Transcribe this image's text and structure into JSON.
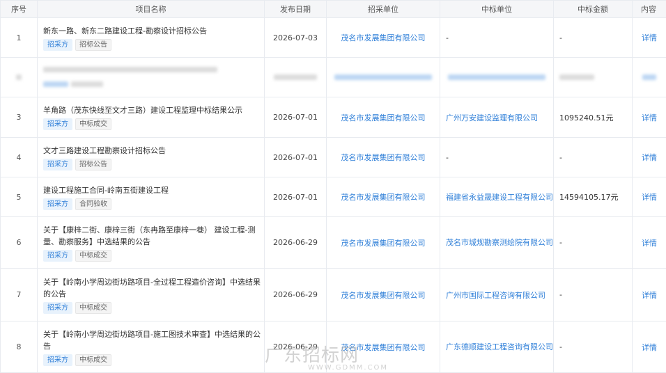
{
  "headers": {
    "no": "序号",
    "name": "项目名称",
    "date": "发布日期",
    "buyer": "招采单位",
    "winner": "中标单位",
    "amount": "中标金额",
    "content": "内容"
  },
  "rows": [
    {
      "no": "1",
      "title": "新东一路、新东二路建设工程-勘察设计招标公告",
      "tag1": "招采方",
      "tag2": "招标公告",
      "date": "2026-07-03",
      "buyer": "茂名市发展集团有限公司",
      "winner": "-",
      "amount": "-",
      "detail": "详情"
    },
    {
      "no": "3",
      "title": "羊角路（茂东快线至文才三路）建设工程监理中标结果公示",
      "tag1": "招采方",
      "tag2": "中标成交",
      "date": "2026-07-01",
      "buyer": "茂名市发展集团有限公司",
      "winner": "广州万安建设监理有限公司",
      "amount": "1095240.51元",
      "detail": "详情"
    },
    {
      "no": "4",
      "title": "文才三路建设工程勘察设计招标公告",
      "tag1": "招采方",
      "tag2": "招标公告",
      "date": "2026-07-01",
      "buyer": "茂名市发展集团有限公司",
      "winner": "-",
      "amount": "-",
      "detail": "详情"
    },
    {
      "no": "5",
      "title": "建设工程施工合同-岭南五街建设工程",
      "tag1": "招采方",
      "tag2": "合同验收",
      "date": "2026-07-01",
      "buyer": "茂名市发展集团有限公司",
      "winner": "福建省永益晟建设工程有限公司",
      "amount": "14594105.17元",
      "detail": "详情"
    },
    {
      "no": "6",
      "title": "关于【康梓二街、康梓三街（东冉路至康梓一巷） 建设工程-测量、勘察服务】中选结果的公告",
      "tag1": "招采方",
      "tag2": "中标成交",
      "date": "2026-06-29",
      "buyer": "茂名市发展集团有限公司",
      "winner": "茂名市城规勘察测绘院有限公司",
      "amount": "-",
      "detail": "详情"
    },
    {
      "no": "7",
      "title": "关于【岭南小学周边街坊路项目-全过程工程造价咨询】中选结果的公告",
      "tag1": "招采方",
      "tag2": "中标成交",
      "date": "2026-06-29",
      "buyer": "茂名市发展集团有限公司",
      "winner": "广州市国际工程咨询有限公司",
      "amount": "-",
      "detail": "详情"
    },
    {
      "no": "8",
      "title": "关于【岭南小学周边街坊路项目-施工图技术审查】中选结果的公告",
      "tag1": "招采方",
      "tag2": "中标成交",
      "date": "2026-06-29",
      "buyer": "茂名市发展集团有限公司",
      "winner": "广东德顺建设工程咨询有限公司",
      "amount": "-",
      "detail": "详情"
    }
  ],
  "watermark": {
    "main": "广东招标网",
    "sub": "WWW.GDMM.COM"
  }
}
